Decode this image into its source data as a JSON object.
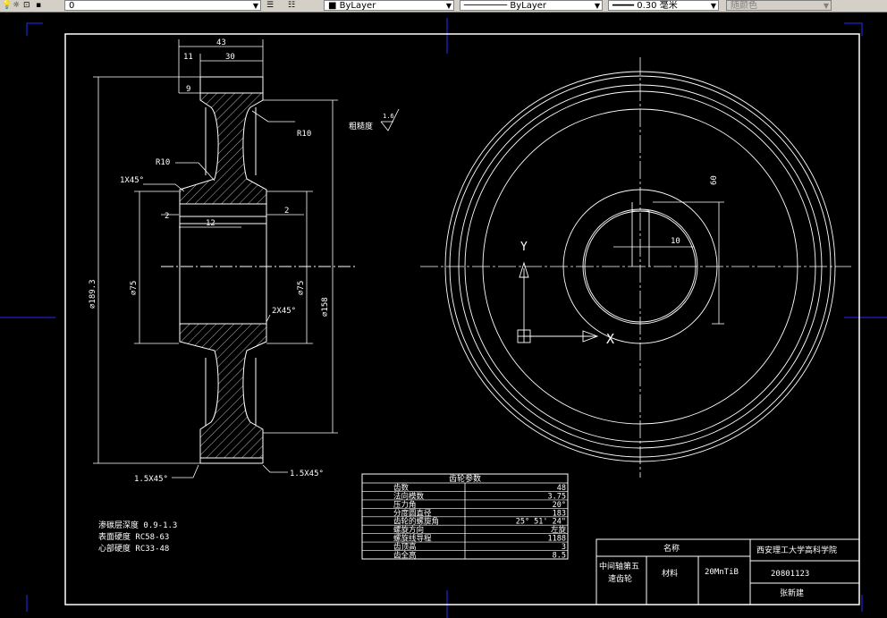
{
  "toolbar": {
    "layer_value": "0",
    "color_value": "ByLayer",
    "linetype_value": "ByLayer",
    "lineweight_value": "0.30 毫米",
    "plotstyle_value": "随颜色"
  },
  "drawing": {
    "dims": {
      "d43": "43",
      "d11": "11",
      "d30": "30",
      "d9": "9",
      "r10_right": "R10",
      "r10_left": "R10",
      "chamfer_1x45": "1X45°",
      "d2_left": "2",
      "d12": "12",
      "d2_right": "2",
      "dia_189": "⌀189.3",
      "dia_75_left": "⌀75",
      "dia_75_right": "⌀75",
      "dia_158": "⌀158",
      "chamfer_2x45": "2X45°",
      "chamfer_15x45_left": "1.5X45°",
      "chamfer_15x45_right": "1.5X45°",
      "d60": "60",
      "d10": "10"
    },
    "roughness_label": "粗糙度",
    "roughness_value": "1.6",
    "ucs_y": "Y",
    "ucs_x": "X",
    "notes": [
      "渗碳层深度 0.9-1.3",
      "表面硬度 RC58-63",
      "心部硬度 RC33-48"
    ]
  },
  "gear_table": {
    "title": "齿轮参数",
    "rows": [
      {
        "name": "齿数",
        "value": "48"
      },
      {
        "name": "法向模数",
        "value": "3.75"
      },
      {
        "name": "压力角",
        "value": "20°"
      },
      {
        "name": "分度圆直径",
        "value": "183"
      },
      {
        "name": "齿轮的螺旋角",
        "value": "25° 51' 24\""
      },
      {
        "name": "螺旋方向",
        "value": "左旋"
      },
      {
        "name": "螺旋线导程",
        "value": "1188"
      },
      {
        "name": "齿顶高",
        "value": "3"
      },
      {
        "name": "齿全高",
        "value": "8.5"
      }
    ]
  },
  "title_block": {
    "name_label": "名称",
    "school": "西安理工大学高科学院",
    "part_name_line1": "中间轴第五",
    "part_name_line2": "速齿轮",
    "material_label": "材料",
    "material_value": "20MnTiB",
    "student_id": "20801123",
    "author": "张新建"
  }
}
